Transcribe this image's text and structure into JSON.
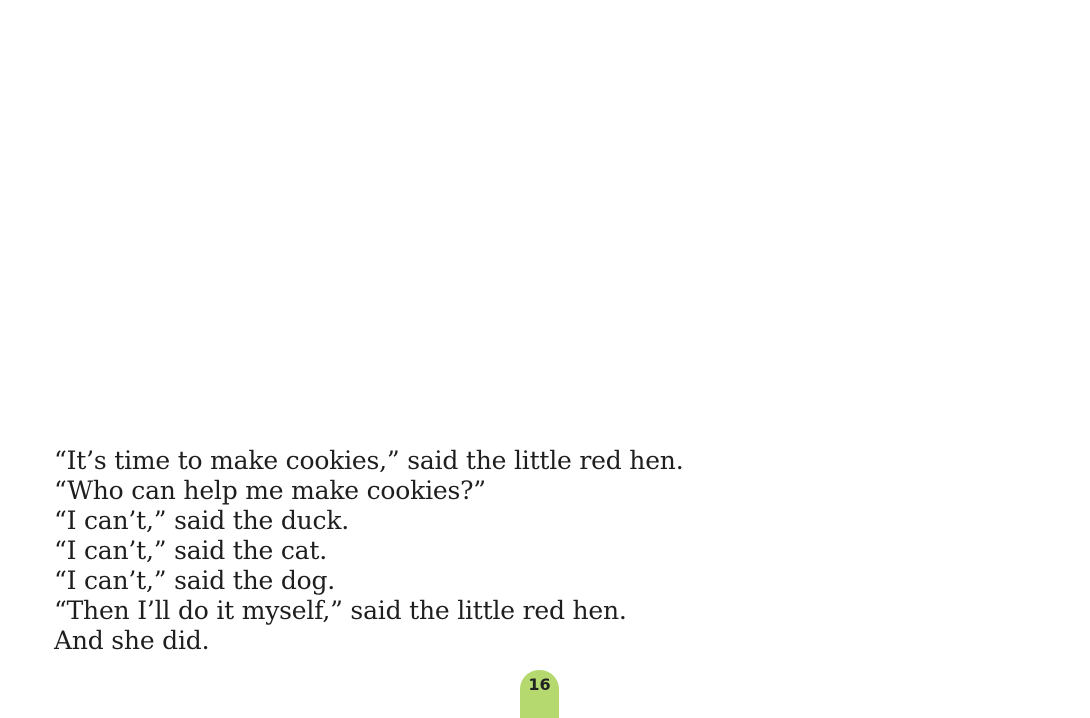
{
  "story": {
    "lines": [
      "“It’s time to make cookies,” said the little red hen.",
      "“Who can help me make cookies?”",
      "“I can’t,” said the duck.",
      "“I can’t,” said the cat.",
      "“I can’t,” said the dog.",
      "“Then I’ll do it myself,” said the little red hen.",
      "And she did."
    ]
  },
  "footer": {
    "page_number": "16",
    "tab_color": "#b5d96f"
  }
}
